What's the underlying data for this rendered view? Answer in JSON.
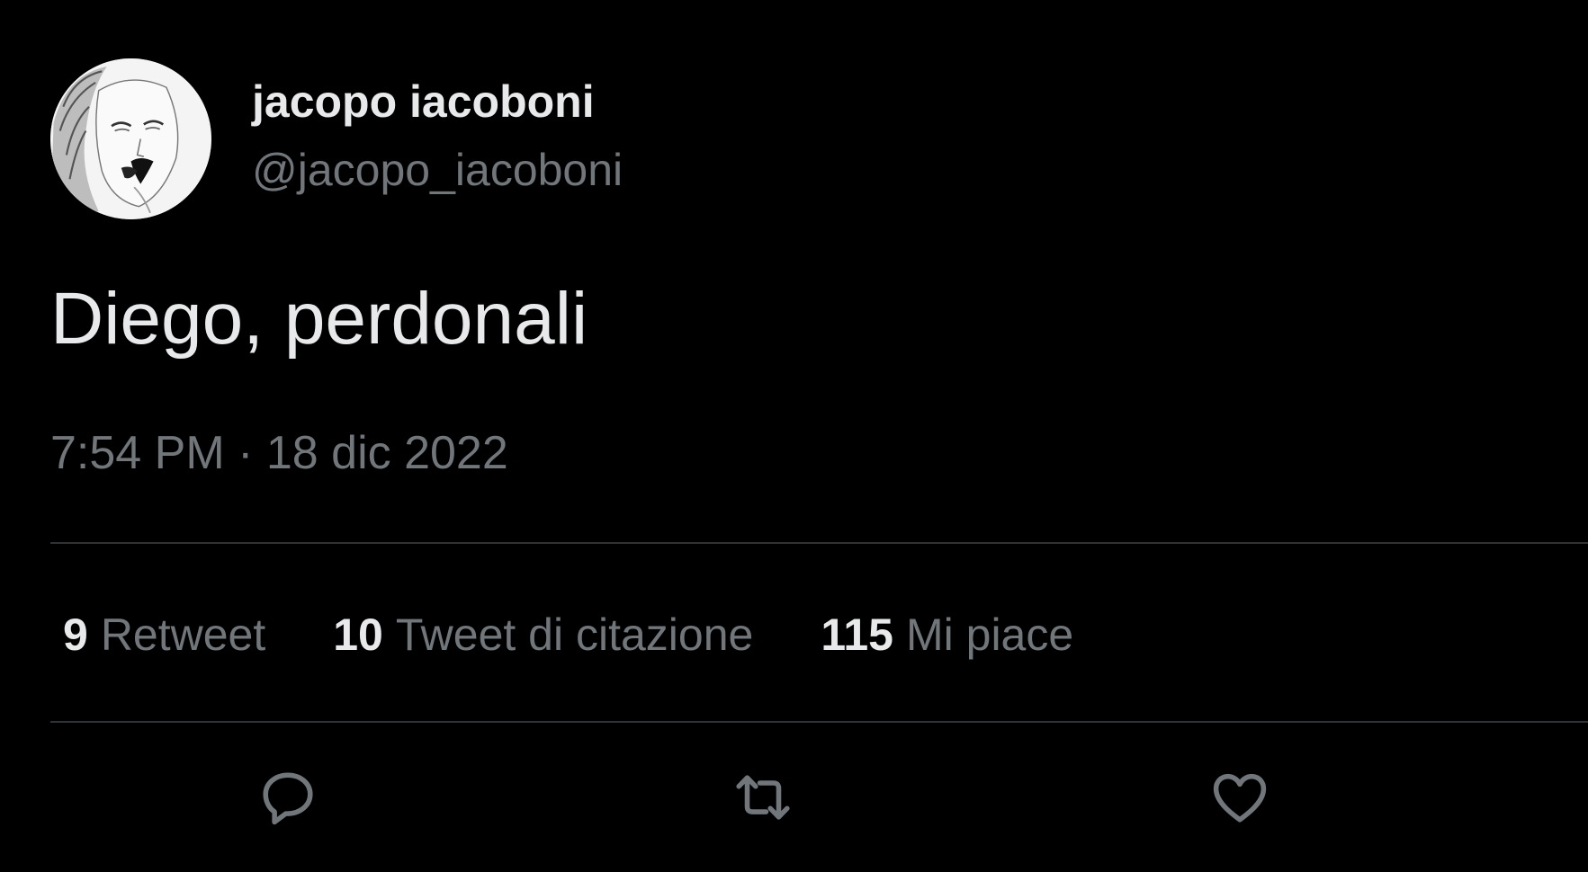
{
  "tweet": {
    "author": {
      "display_name": "jacopo iacoboni",
      "handle": "@jacopo_iacoboni"
    },
    "text": "Diego, perdonali",
    "timestamp": "7:54 PM · 18 dic 2022",
    "stats": [
      {
        "count": "9",
        "label": "Retweet"
      },
      {
        "count": "10",
        "label": "Tweet di citazione"
      },
      {
        "count": "115",
        "label": "Mi piace"
      }
    ],
    "actions": {
      "reply_icon": "reply-icon",
      "retweet_icon": "retweet-icon",
      "like_icon": "heart-icon"
    }
  },
  "colors": {
    "background": "#000000",
    "primary_text": "#e7e9ea",
    "secondary_text": "#71767b",
    "divider": "#2f3336"
  }
}
